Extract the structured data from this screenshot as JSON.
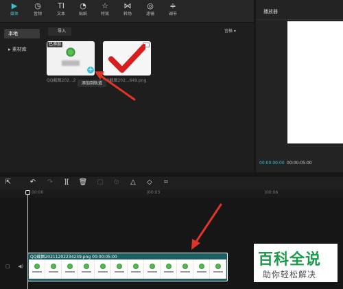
{
  "toolbar": {
    "items": [
      {
        "label": "媒体",
        "icon": "media-icon",
        "glyph": "▶"
      },
      {
        "label": "音频",
        "icon": "audio-icon",
        "glyph": "◷"
      },
      {
        "label": "文本",
        "icon": "text-icon",
        "glyph": "TI"
      },
      {
        "label": "贴纸",
        "icon": "sticker-icon",
        "glyph": "◔"
      },
      {
        "label": "特效",
        "icon": "effects-icon",
        "glyph": "☆"
      },
      {
        "label": "转场",
        "icon": "transition-icon",
        "glyph": "⋈"
      },
      {
        "label": "滤镜",
        "icon": "filter-icon",
        "glyph": "◎"
      },
      {
        "label": "调节",
        "icon": "adjust-icon",
        "glyph": "≑"
      }
    ]
  },
  "sidenav": {
    "items": [
      {
        "label": "本地"
      },
      {
        "label": "▸ 素材库"
      }
    ]
  },
  "media": {
    "import_label": "导入",
    "view_label": "宫格 ▾",
    "items": [
      {
        "badge": "已添加",
        "filename": "QQ截图202...2"
      },
      {
        "badge": "",
        "filename": "QQ截图202...649.png"
      }
    ],
    "add_button": "+",
    "tooltip": "添加到轨道"
  },
  "player": {
    "title": "播放器",
    "time_current": "00:00:00:00",
    "time_total": "00:00:05:00"
  },
  "timeline": {
    "tools": [
      "⇱",
      "↶",
      "↷",
      "][",
      "🗑",
      "▢",
      "⊙",
      "△",
      "◇",
      "⌗"
    ],
    "ruler_ticks": [
      "00:00",
      "|00:03",
      "|00:06"
    ],
    "clip_label": "QQ截图20211202234239.png   00:00:05:00"
  },
  "watermark": {
    "logo": "百科全说",
    "subtitle": "助你轻松解决"
  },
  "colors": {
    "accent": "#3fc0d8",
    "arrow": "#e0342b",
    "clip": "#1b5f63"
  }
}
